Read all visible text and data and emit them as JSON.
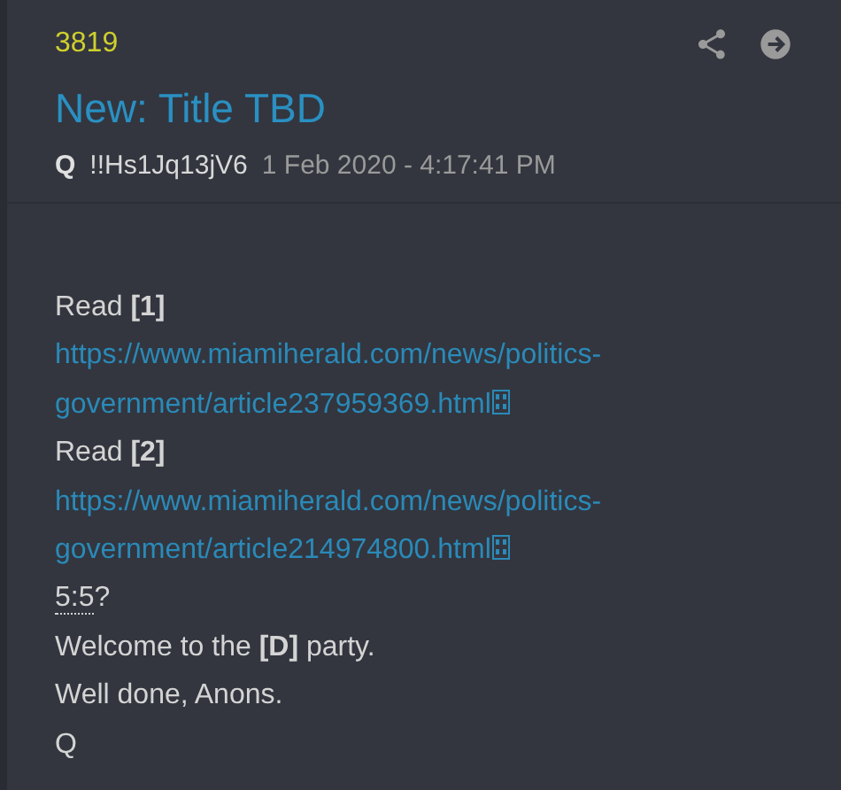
{
  "post": {
    "number": "3819",
    "title": "New: Title TBD",
    "author": "Q",
    "tripcode": "!!Hs1Jq13jV6",
    "timestamp": "1 Feb 2020 - 4:17:41 PM"
  },
  "body": [
    {
      "kind": "text",
      "text": "Read **[1]**"
    },
    {
      "kind": "link",
      "text": "https://www.miamiherald.com/news/politics-government/article237959369.html"
    },
    {
      "kind": "text",
      "text": "Read **[2]**"
    },
    {
      "kind": "link",
      "text": "https://www.miamiherald.com/news/politics-government/article214974800.html"
    },
    {
      "kind": "abbr",
      "text": "5:5",
      "suffix": "?"
    },
    {
      "kind": "text",
      "text": "Welcome to the **[D]** party."
    },
    {
      "kind": "text",
      "text": "Well done, Anons."
    },
    {
      "kind": "text",
      "text": "Q"
    }
  ]
}
